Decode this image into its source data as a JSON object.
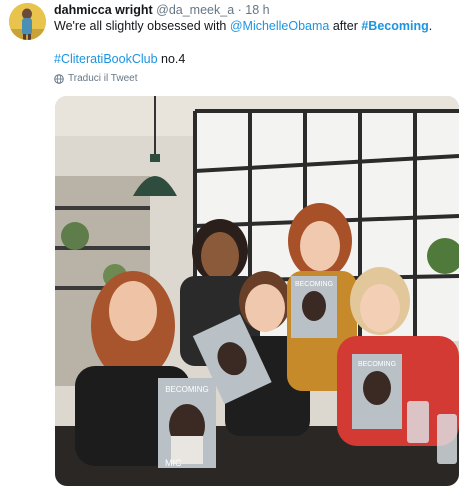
{
  "tweet": {
    "author_name": "dahmicca wright",
    "handle": "@da_meek_a",
    "separator": "·",
    "time": "18 h",
    "text_part1": "We're all slightly obsessed with ",
    "mention": "@MichelleObama",
    "text_part2": " after ",
    "hashtag_becoming": "#Becoming",
    "text_part3": ".",
    "hashtag_club": "#CliteratiBookClub",
    "club_suffix": " no.4",
    "translate_label": "Traduci il Tweet"
  },
  "photo": {
    "book_title": "BECOMING",
    "book_author_fragment": "MIC"
  },
  "colors": {
    "link": "#1b95e0",
    "muted": "#657786",
    "text": "#14171a"
  }
}
